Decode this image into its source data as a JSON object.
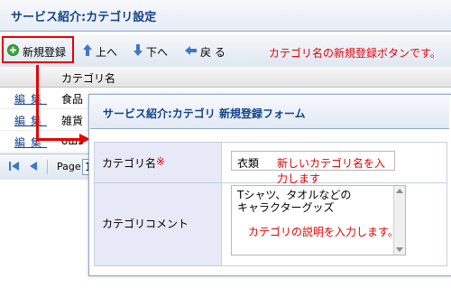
{
  "panel": {
    "title": "サービス紹介:カテゴリ設定"
  },
  "toolbar": {
    "new_label": "新規登録",
    "up_label": "上へ",
    "down_label": "下へ",
    "back_label": "戻 る",
    "annotation": "カテゴリ名の新規登録ボタンです。"
  },
  "grid": {
    "column_header": "カテゴリ名",
    "rows": [
      {
        "action": "編集",
        "name": "食品"
      },
      {
        "action": "編集",
        "name": "雑貨"
      },
      {
        "action": "編集",
        "name": "ошs"
      }
    ]
  },
  "pager": {
    "page_label": "Page",
    "page_value": "1"
  },
  "dialog": {
    "title": "サービス紹介:カテゴリ  新規登録フォーム",
    "name_label": "カテゴリ名",
    "required_mark": "※",
    "name_value": "衣類",
    "name_note": "新しいカテゴリ名を入力します",
    "comment_label": "カテゴリコメント",
    "comment_line1": "Tシャツ、タオルなどの",
    "comment_line2": "キャラクターグッズ",
    "comment_note": "カテゴリの説明を入力します。"
  },
  "colors": {
    "highlight_red": "#e60000",
    "title_blue": "#15428b",
    "label_bg": "#e8e9f7"
  }
}
